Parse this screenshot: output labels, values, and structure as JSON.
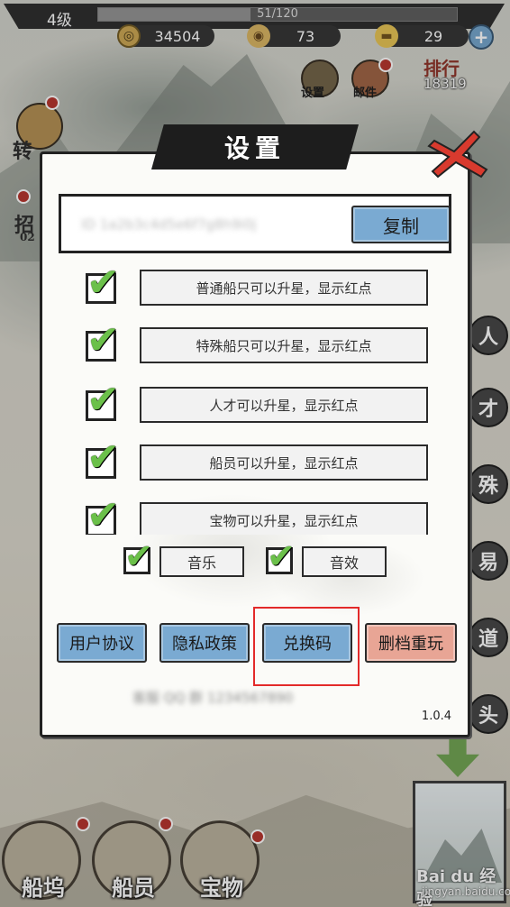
{
  "status_bar": {
    "level": "4级",
    "xp_text": "51/120",
    "xp_fraction": 0.425,
    "coins": "34504",
    "shells": "73",
    "ingots": "29",
    "plus_icon": "plus-icon"
  },
  "top_icons": {
    "settings_label": "设置",
    "mail_label": "邮件",
    "rank_title": "排行",
    "rank_value": "18319"
  },
  "left_side": {
    "item1": "转",
    "item2": "招",
    "item2_sub": "02"
  },
  "right_side": {
    "items": [
      "人",
      "才",
      "殊",
      "易",
      "道",
      "头"
    ]
  },
  "dialog": {
    "title": "设置",
    "id_text": "ID 1a2b3c4d5e6f7g8h9i0j",
    "copy_label": "复制",
    "options": [
      {
        "label": "普通船只可以升星，显示红点",
        "checked": true
      },
      {
        "label": "特殊船只可以升星，显示红点",
        "checked": true
      },
      {
        "label": "人才可以升星，显示红点",
        "checked": true
      },
      {
        "label": "船员可以升星，显示红点",
        "checked": true
      },
      {
        "label": "宝物可以升星，显示红点",
        "checked": true
      }
    ],
    "music_label": "音乐",
    "sfx_label": "音效",
    "user_agreement": "用户协议",
    "privacy_policy": "隐私政策",
    "redeem_code": "兑换码",
    "delete_restart": "删档重玩",
    "blurred_line": "客服 QQ 群 1234567890",
    "version": "1.0.4",
    "check_symbol": "✔"
  },
  "bottom_nav": {
    "items": [
      "船坞",
      "船员",
      "宝物"
    ]
  },
  "watermark": {
    "brand": "Bai du 经验",
    "url": "jingyan.baidu.com"
  },
  "colors": {
    "button_blue": "#7aaad2",
    "button_red": "#e8a595",
    "check_green": "#6bc04a",
    "highlight_red": "#e32a2a"
  }
}
